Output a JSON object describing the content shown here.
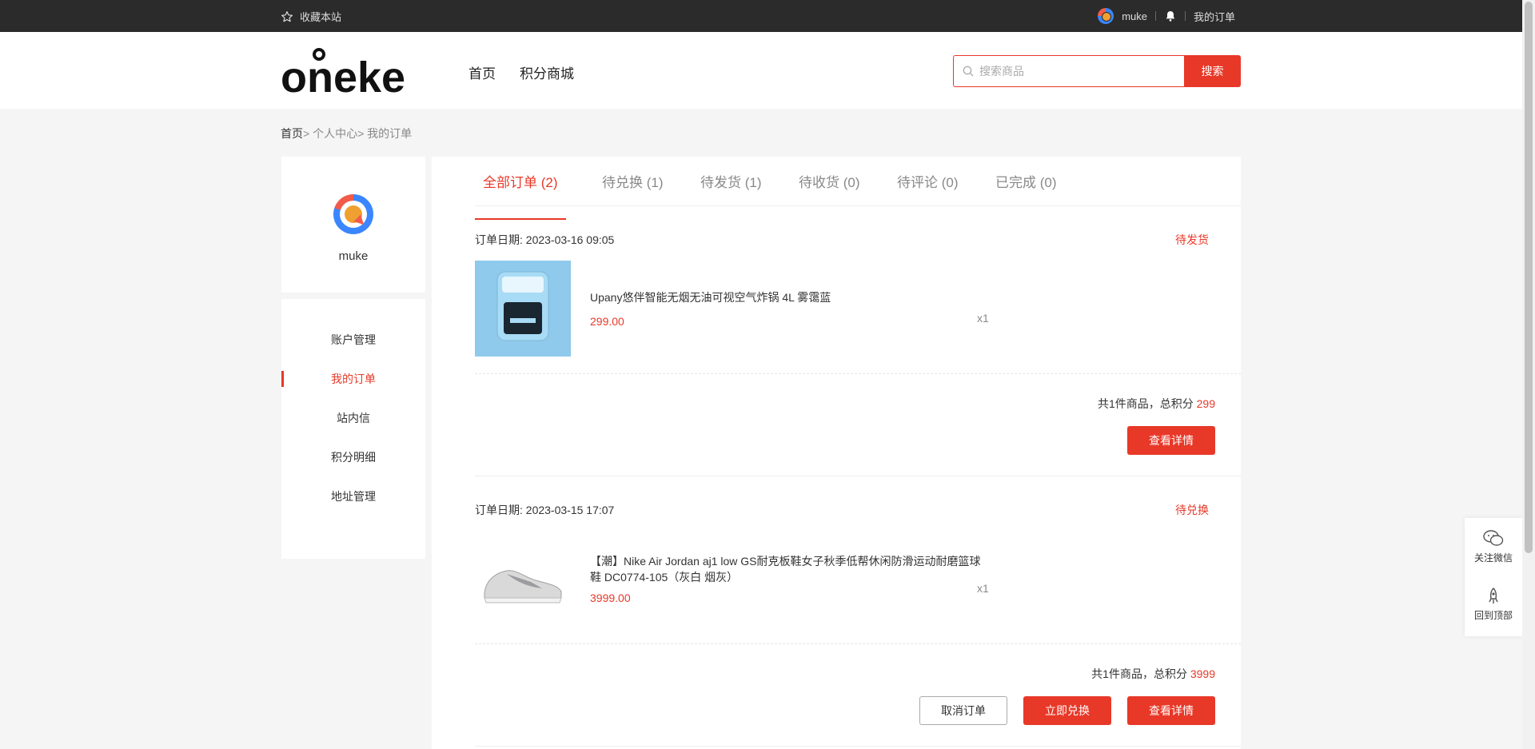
{
  "topbar": {
    "favorite": "收藏本站",
    "username": "muke",
    "my_orders": "我的订单"
  },
  "header": {
    "logo_text": "onekey",
    "nav": [
      "首页",
      "积分商城"
    ],
    "search_placeholder": "搜索商品",
    "search_button": "搜索"
  },
  "breadcrumb": {
    "home": "首页",
    "rest": "> 个人中心> 我的订单"
  },
  "profile": {
    "name": "muke"
  },
  "sidebar_menu": [
    "账户管理",
    "我的订单",
    "站内信",
    "积分明细",
    "地址管理"
  ],
  "tabs": [
    "全部订单 (2)",
    "待兑换 (1)",
    "待发货 (1)",
    "待收货 (0)",
    "待评论 (0)",
    "已完成 (0)"
  ],
  "orders": [
    {
      "date": "订单日期: 2023-03-16 09:05",
      "status": "待发货",
      "product_name": "Upany悠伴智能无烟无油可视空气炸锅 4L 雾霭蓝",
      "price": "299.00",
      "qty": "x1",
      "summary_prefix": "共1件商品，总积分",
      "points": "299",
      "buttons": [
        "查看详情"
      ]
    },
    {
      "date": "订单日期: 2023-03-15 17:07",
      "status": "待兑换",
      "product_name": "【潮】Nike Air Jordan aj1 low GS耐克板鞋女子秋季低帮休闲防滑运动耐磨篮球鞋 DC0774-105（灰白 烟灰）",
      "price": "3999.00",
      "qty": "x1",
      "summary_prefix": "共1件商品，总积分",
      "points": "3999",
      "buttons": [
        "取消订单",
        "立即兑换",
        "查看详情"
      ]
    }
  ],
  "float_panel": {
    "wechat": "关注微信",
    "back_top": "回到顶部"
  },
  "colors": {
    "accent": "#e83828",
    "topbar_bg": "#2b2b2b",
    "page_bg": "#f5f5f5"
  }
}
